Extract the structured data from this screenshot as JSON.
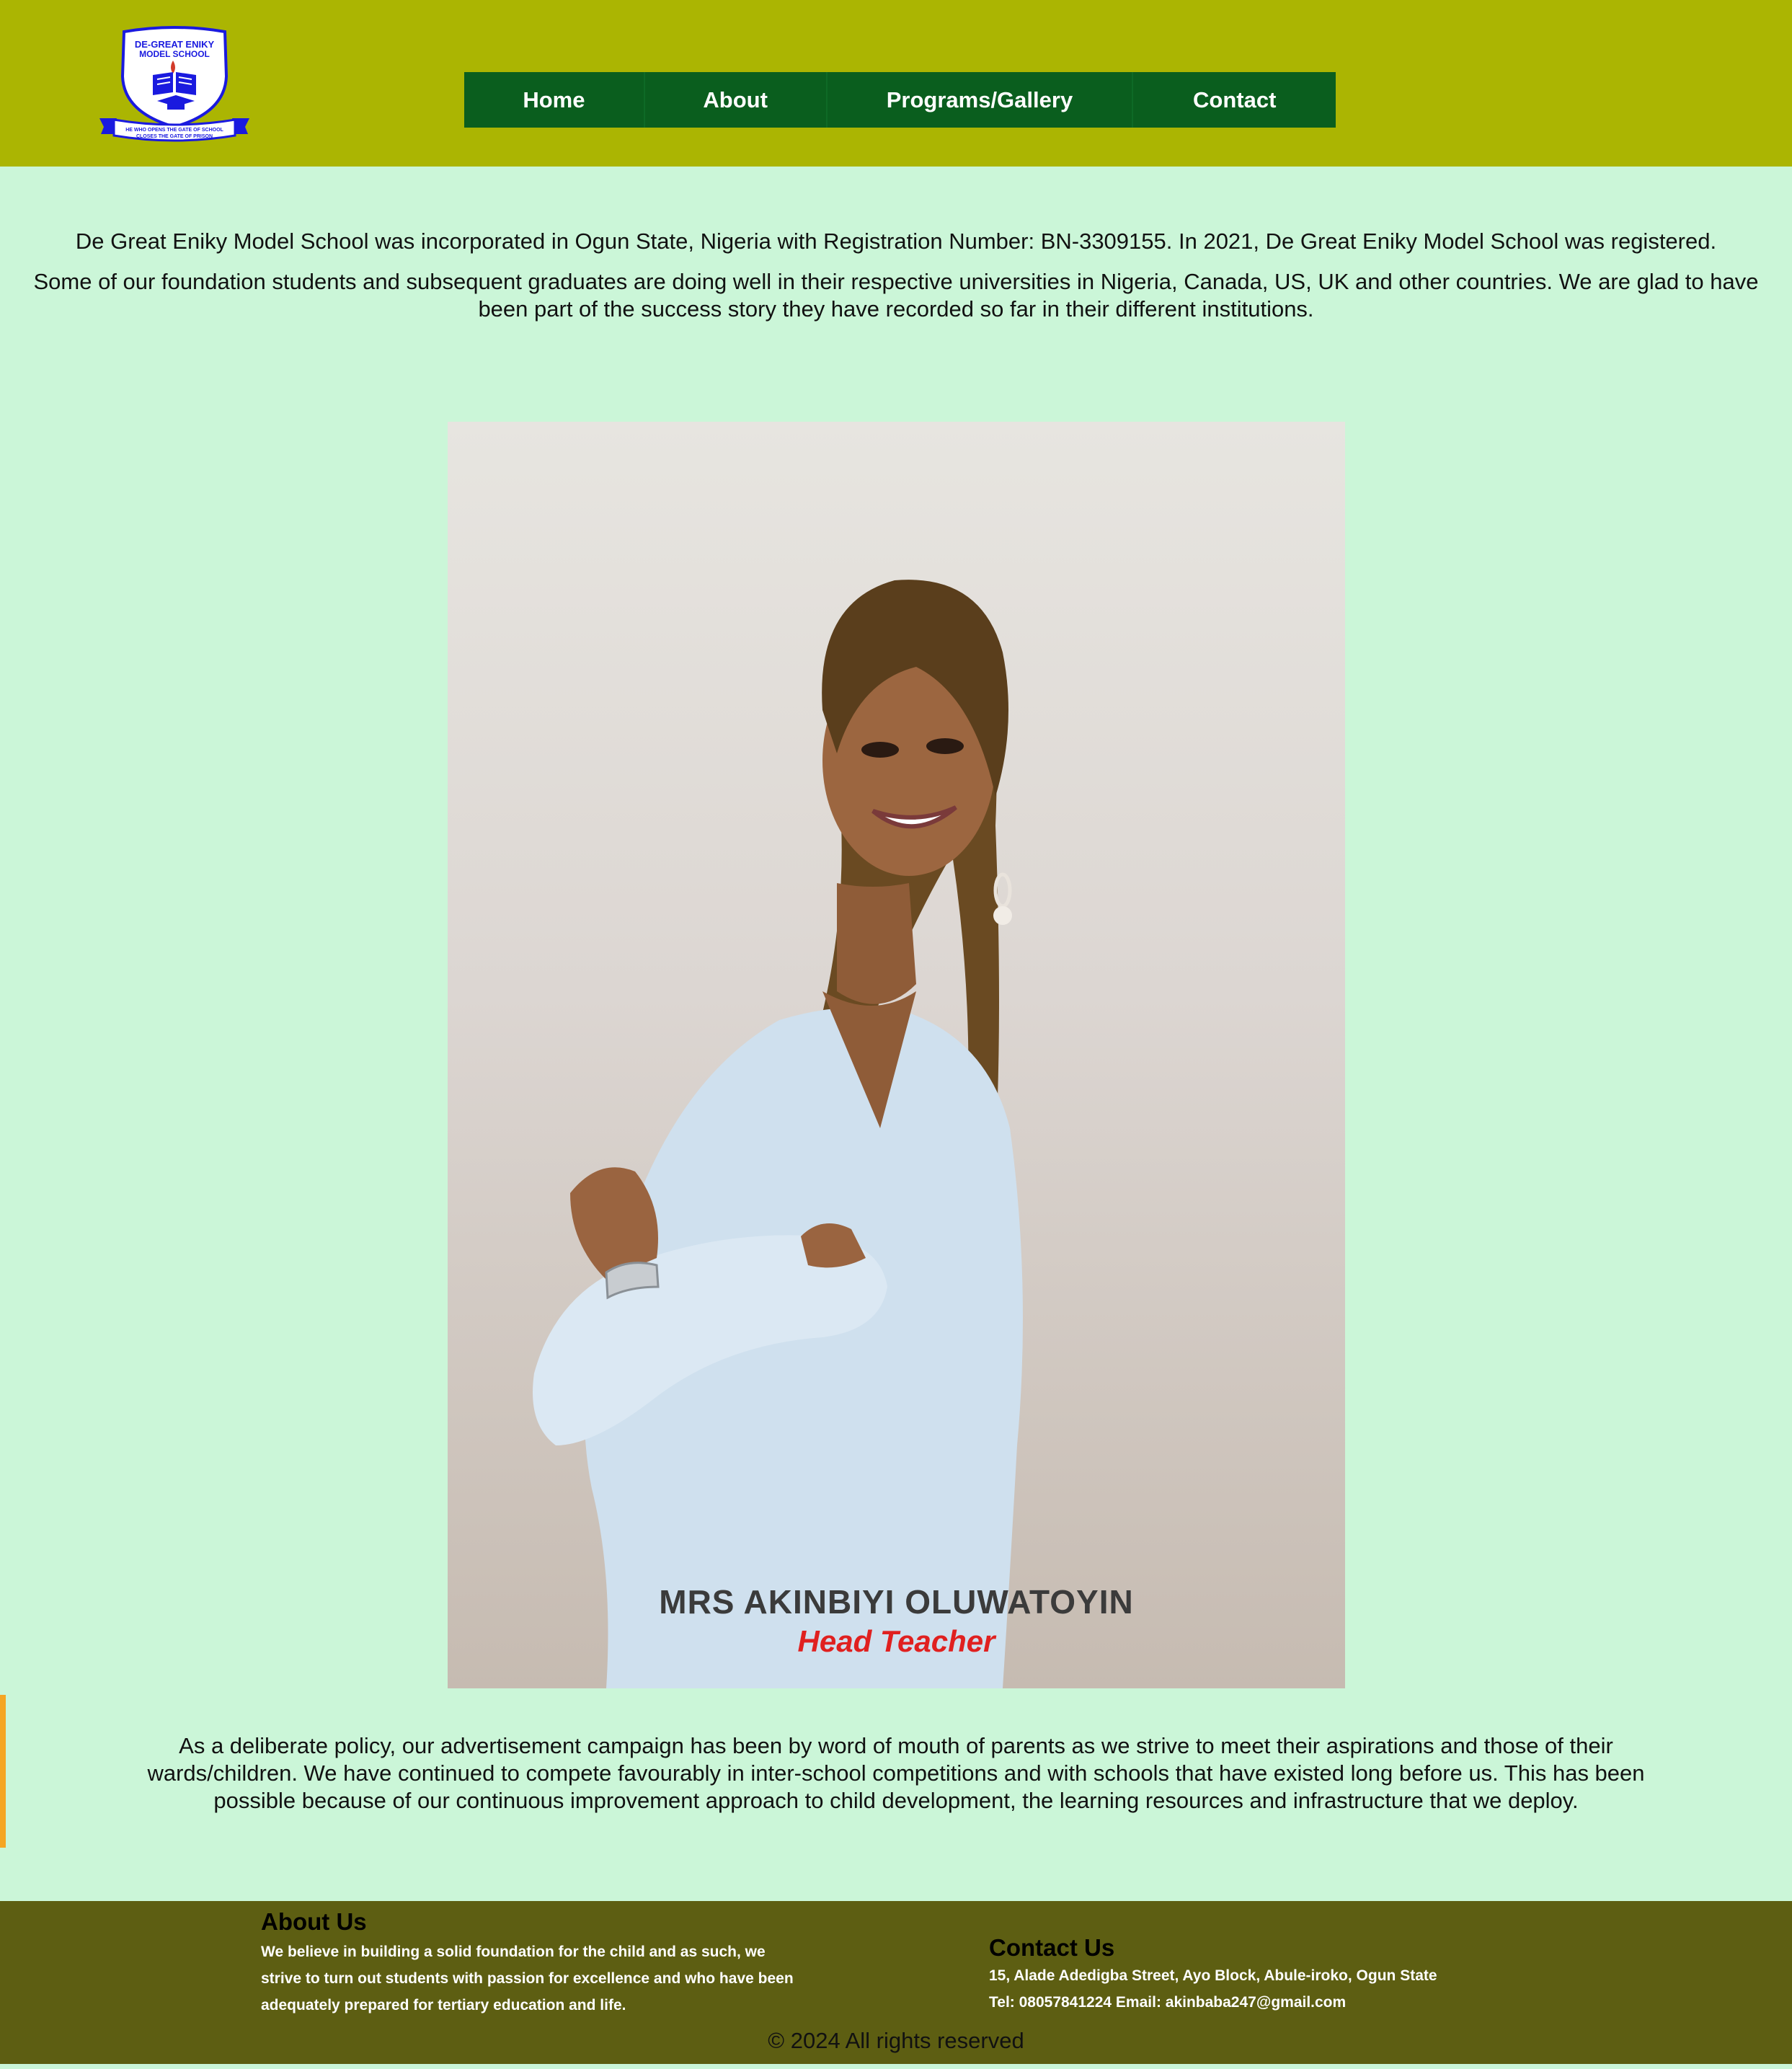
{
  "header": {
    "logo": {
      "title_line1": "DE-GREAT ENIKY",
      "title_line2": "MODEL SCHOOL",
      "motto_line1": "HE WHO OPENS THE GATE OF SCHOOL",
      "motto_line2": "CLOSES THE GATE OF PRISON"
    },
    "nav": [
      "Home",
      "About",
      "Programs/Gallery",
      "Contact"
    ]
  },
  "intro": {
    "paragraph1": "De Great Eniky Model School was incorporated in Ogun State, Nigeria with Registration Number: BN-3309155. In 2021, De Great Eniky Model School was registered.",
    "paragraph2": "Some of our foundation students and subsequent graduates are doing well in their respective universities in Nigeria, Canada, US, UK and other countries. We are glad to have been part of the success story they have recorded so far in their different institutions."
  },
  "head_teacher": {
    "name": "MRS AKINBIYI OLUWATOYIN",
    "role": "Head Teacher"
  },
  "policy": "As a deliberate policy, our advertisement campaign has been by word of mouth of parents as we strive to meet their aspirations and those of their wards/children. We have continued to compete favourably in inter-school competitions and with schools that have existed long before us. This has been possible because of our continuous improvement approach to child development, the learning resources and infrastructure that we deploy.",
  "footer": {
    "about_heading": "About Us",
    "about_text": "We believe in building a solid foundation for the child and as such, we strive to turn out students with passion for excellence and who have been adequately prepared for tertiary education and life.",
    "contact_heading": "Contact Us",
    "contact_address": "15, Alade Adedigba Street, Ayo Block, Abule-iroko, Ogun State",
    "contact_tel": "Tel: 08057841224 Email: akinbaba247@gmail.com",
    "copyright": "© 2024 All rights reserved"
  },
  "colors": {
    "page_bg": "#cbf6d8",
    "header_bg": "#abb502",
    "nav_bg": "#0a5e1e",
    "footer_bg": "#5d5e12",
    "accent": "#f5a623",
    "role_text": "#e0201f"
  }
}
